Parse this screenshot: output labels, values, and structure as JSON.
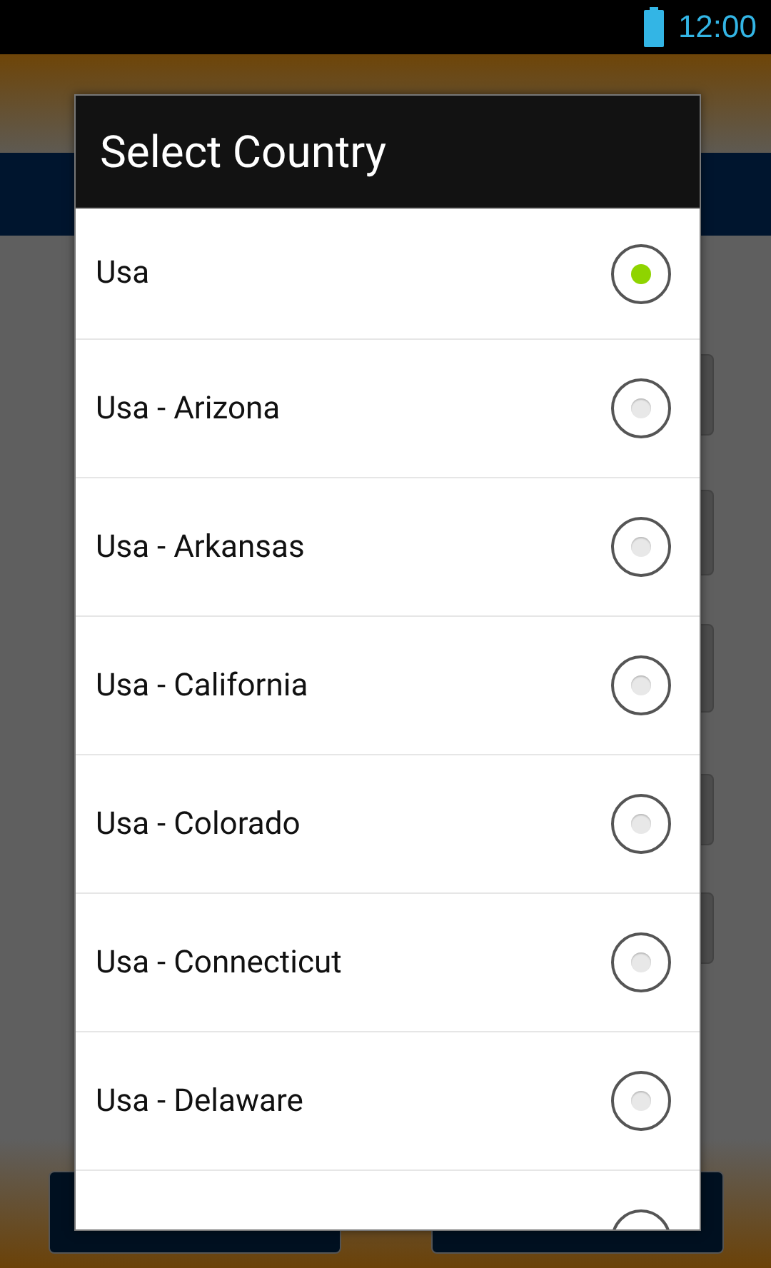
{
  "status_bar": {
    "time": "12:00"
  },
  "dialog": {
    "title": "Select Country",
    "items": [
      {
        "label": "Usa",
        "selected": true
      },
      {
        "label": "Usa - Arizona",
        "selected": false
      },
      {
        "label": "Usa - Arkansas",
        "selected": false
      },
      {
        "label": "Usa - California",
        "selected": false
      },
      {
        "label": "Usa - Colorado",
        "selected": false
      },
      {
        "label": "Usa - Connecticut",
        "selected": false
      },
      {
        "label": "Usa - Delaware",
        "selected": false
      }
    ]
  }
}
